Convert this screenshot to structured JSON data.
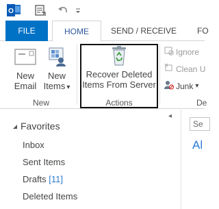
{
  "quick_access": {
    "app_icon": "outlook-icon",
    "app_icon_letter": "O",
    "send_receive_icon": "send-receive-all-icon",
    "undo_icon": "undo-icon",
    "customize_icon": "customize-dropdown-icon"
  },
  "tabs": [
    {
      "label": "FILE"
    },
    {
      "label": "HOME"
    },
    {
      "label": "SEND / RECEIVE"
    },
    {
      "label": "FO"
    }
  ],
  "ribbon": {
    "new_email": {
      "line1": "New",
      "line2": "Email",
      "icon": "envelope-icon"
    },
    "new_items": {
      "line1": "New",
      "line2": "Items",
      "dropdown": "▾",
      "icon": "new-items-icon"
    },
    "new_group_label": "New",
    "recover": {
      "line1": "Recover Deleted",
      "line2": "Items From Server",
      "icon": "recycle-bin-icon"
    },
    "actions_group_label": "Actions",
    "ignore": {
      "label": "Ignore",
      "icon": "ignore-icon"
    },
    "clean_up": {
      "label": "Clean U",
      "icon": "clean-up-icon"
    },
    "junk": {
      "label": "Junk",
      "dropdown": "▾",
      "icon": "junk-icon"
    },
    "delete_group_label": "De"
  },
  "nav": {
    "favorites": {
      "label": "Favorites",
      "icon": "collapse-triangle-icon"
    },
    "items": [
      {
        "label": "Inbox",
        "count": ""
      },
      {
        "label": "Sent Items",
        "count": ""
      },
      {
        "label": "Drafts",
        "count": "[11]"
      },
      {
        "label": "Deleted Items",
        "count": ""
      }
    ],
    "collapse_arrow": "◂"
  },
  "right_pane": {
    "search_placeholder": "Se",
    "filter_all": "Al"
  },
  "colors": {
    "file_tab": "#0072c6",
    "home_tab_text": "#2b579a",
    "accent_blue": "#2b7bd3"
  }
}
